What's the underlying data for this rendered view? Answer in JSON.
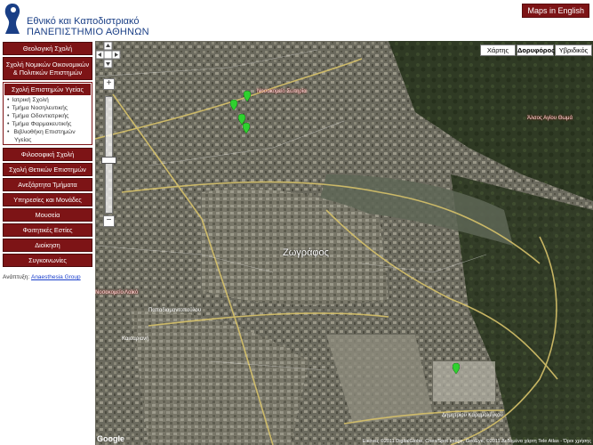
{
  "header": {
    "title_line1": "Εθνικό και Καποδιστριακό",
    "title_line2": "ΠΑΝΕΠΙΣΤΗΜΙΟ ΑΘΗΝΩΝ",
    "maps_english": "Maps in English"
  },
  "sidebar": {
    "theology": "Θεολογική Σχολή",
    "law_econ": "Σχολή Νομικών Οικονομικών & Πολιτικών Επιστημών",
    "health": "Σχολή Επιστημών Υγείας",
    "health_items": [
      "Ιατρική Σχολή",
      "Τμήμα Νοσηλευτικής",
      "Τμήμα Οδοντιατρικής",
      "Τμήμα Φαρμακευτικής",
      "Βιβλιοθήκη Επιστημών",
      "Υγείας"
    ],
    "philosophy": "Φιλοσοφική Σχολή",
    "science": "Σχολή Θετικών Επιστημών",
    "independent": "Ανεξάρτητα Τμήματα",
    "services": "Υπηρεσίες και Μονάδες",
    "museums": "Μουσεία",
    "dorms": "Φοιτητικές Εστίες",
    "admin": "Διοίκηση",
    "transport": "Συγκοινωνίες",
    "developer_prefix": "Ανάπτυξη:",
    "developer_link": "Anaesthesia Group"
  },
  "map": {
    "type_buttons": [
      "Χάρτης",
      "Δορυφόρος",
      "Υβριδικός"
    ],
    "district_label": "Ζωγράφος",
    "attribution": "Εικόνες ©2011 DigitalGlobe, Cnes/Spot Image, GeoEye, ©2011 Δεδομένα χάρτη Tele Atlas - Όροι χρήσης",
    "google": "Google",
    "street_labels": [
      "Δημητρίου Καραμολέγκου",
      "Παπαδιαμαντοπούλου",
      "Νοσοκομείο Σωτηρία",
      "Νοσοκομείο Λαϊκό",
      "Καισαριανή",
      "Άλσος Αγίου Θωμά",
      "Ζωγράφος"
    ]
  }
}
